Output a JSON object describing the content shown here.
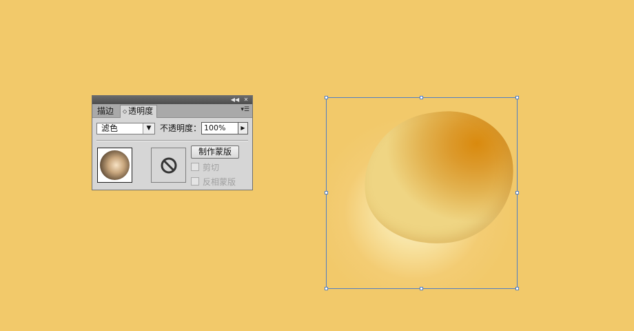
{
  "panel": {
    "tabs": [
      {
        "label": "描边"
      },
      {
        "label": "透明度",
        "active": true
      }
    ],
    "blend_mode": "滤色",
    "opacity_label": "不透明度：",
    "opacity_value": "100%",
    "make_mask_label": "制作蒙版",
    "clip_label": "剪切",
    "invert_mask_label": "反相蒙版",
    "icons": {
      "collapse": "double-chevron-left-icon",
      "close": "close-icon",
      "menu": "panel-menu-icon",
      "no_mask": "prohibited-icon"
    }
  },
  "canvas": {
    "background_color": "#f2c96a",
    "selection_color": "#4f7dc4"
  }
}
